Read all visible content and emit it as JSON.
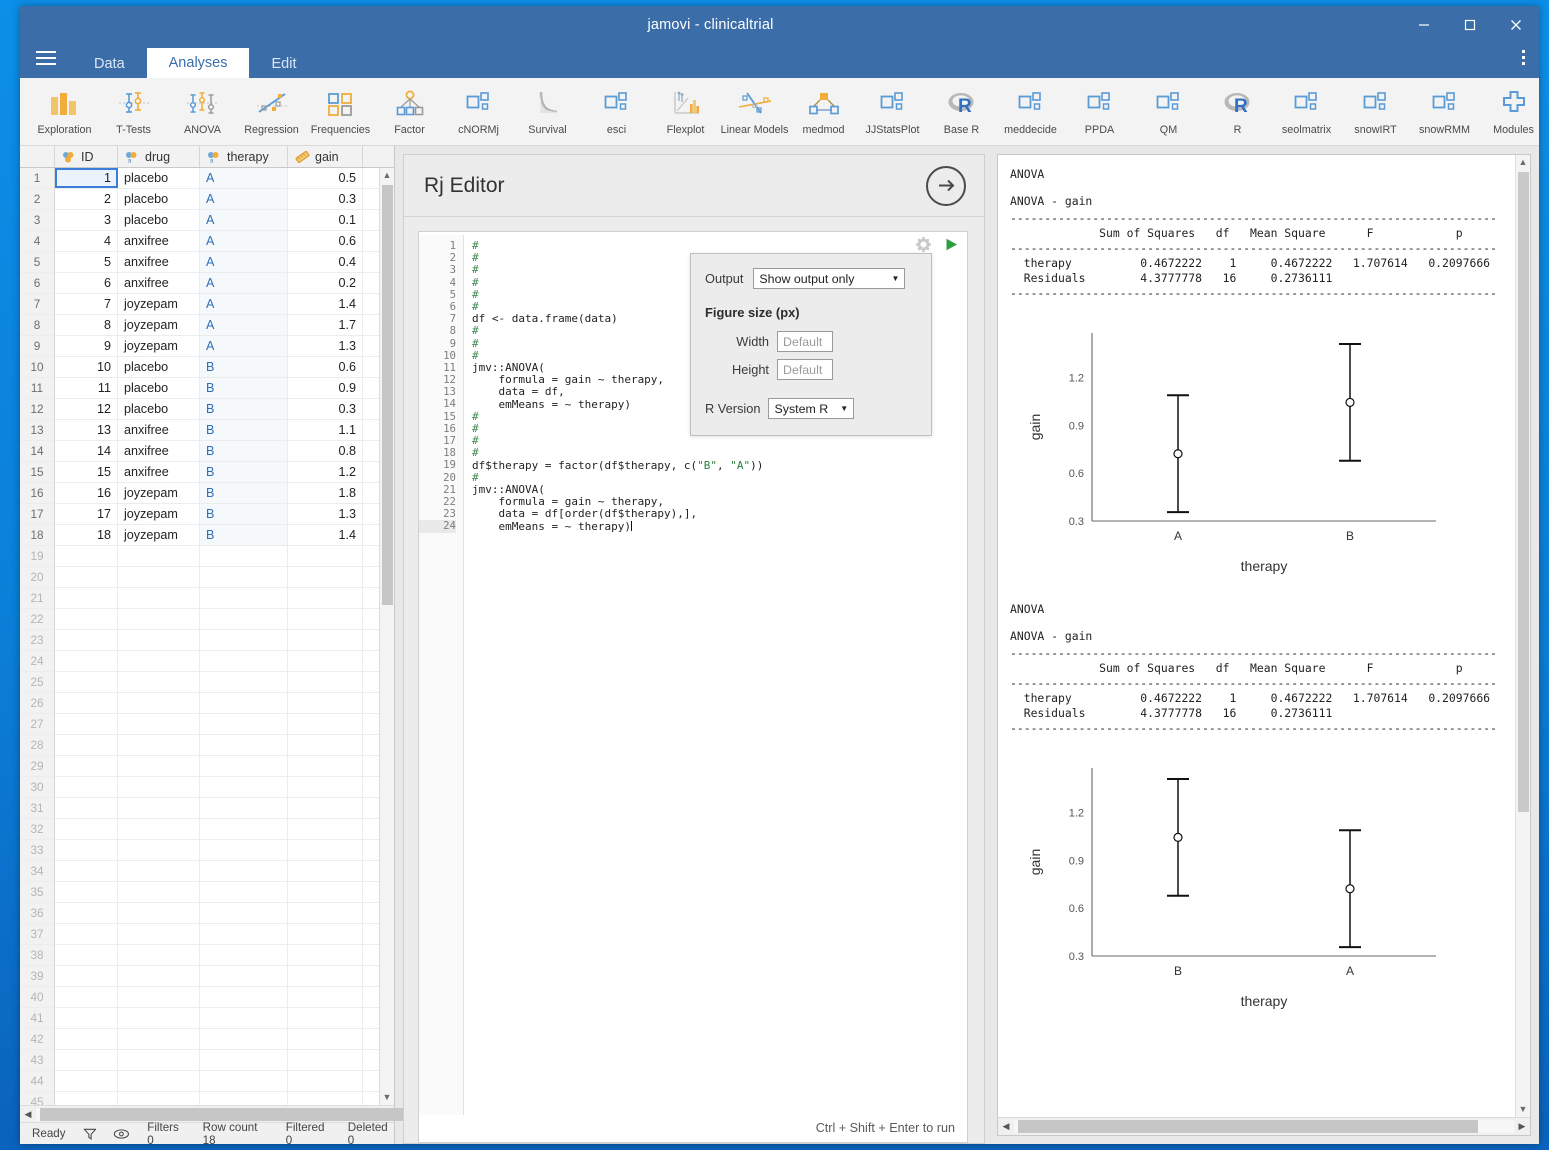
{
  "window": {
    "title": "jamovi - clinicaltrial",
    "minimize": "–",
    "maximize": "❐",
    "close": "✕"
  },
  "tabs": [
    {
      "label": "Data",
      "active": false
    },
    {
      "label": "Analyses",
      "active": true
    },
    {
      "label": "Edit",
      "active": false
    }
  ],
  "ribbon": [
    {
      "label": "Exploration",
      "icon": "bar-chart-icon"
    },
    {
      "label": "T-Tests",
      "icon": "ttest-icon"
    },
    {
      "label": "ANOVA",
      "icon": "anova-icon"
    },
    {
      "label": "Regression",
      "icon": "regression-icon"
    },
    {
      "label": "Frequencies",
      "icon": "frequencies-icon"
    },
    {
      "label": "Factor",
      "icon": "factor-icon"
    },
    {
      "label": "cNORMj",
      "icon": "module-squares-icon"
    },
    {
      "label": "Survival",
      "icon": "survival-curve-icon"
    },
    {
      "label": "esci",
      "icon": "module-squares-icon"
    },
    {
      "label": "Flexplot",
      "icon": "flexplot-icon"
    },
    {
      "label": "Linear Models",
      "icon": "linear-models-icon"
    },
    {
      "label": "medmod",
      "icon": "medmod-icon"
    },
    {
      "label": "JJStatsPlot",
      "icon": "module-squares-icon"
    },
    {
      "label": "Base R",
      "icon": "r-logo-icon"
    },
    {
      "label": "meddecide",
      "icon": "module-squares-icon"
    },
    {
      "label": "PPDA",
      "icon": "module-squares-icon"
    },
    {
      "label": "QM",
      "icon": "module-squares-icon"
    },
    {
      "label": "R",
      "icon": "r-logo-icon"
    },
    {
      "label": "seolmatrix",
      "icon": "module-squares-icon"
    },
    {
      "label": "snowIRT",
      "icon": "module-squares-icon"
    },
    {
      "label": "snowRMM",
      "icon": "module-squares-icon"
    },
    {
      "label": "Modules",
      "icon": "plus-cross-icon"
    }
  ],
  "spreadsheet": {
    "columns": [
      {
        "name": "ID",
        "icon": "nominal-icon"
      },
      {
        "name": "drug",
        "icon": "nominal-text-icon"
      },
      {
        "name": "therapy",
        "icon": "nominal-text-icon"
      },
      {
        "name": "gain",
        "icon": "continuous-ruler-icon"
      }
    ],
    "rows": [
      {
        "n": "1",
        "ID": "1",
        "drug": "placebo",
        "therapy": "A",
        "gain": "0.5"
      },
      {
        "n": "2",
        "ID": "2",
        "drug": "placebo",
        "therapy": "A",
        "gain": "0.3"
      },
      {
        "n": "3",
        "ID": "3",
        "drug": "placebo",
        "therapy": "A",
        "gain": "0.1"
      },
      {
        "n": "4",
        "ID": "4",
        "drug": "anxifree",
        "therapy": "A",
        "gain": "0.6"
      },
      {
        "n": "5",
        "ID": "5",
        "drug": "anxifree",
        "therapy": "A",
        "gain": "0.4"
      },
      {
        "n": "6",
        "ID": "6",
        "drug": "anxifree",
        "therapy": "A",
        "gain": "0.2"
      },
      {
        "n": "7",
        "ID": "7",
        "drug": "joyzepam",
        "therapy": "A",
        "gain": "1.4"
      },
      {
        "n": "8",
        "ID": "8",
        "drug": "joyzepam",
        "therapy": "A",
        "gain": "1.7"
      },
      {
        "n": "9",
        "ID": "9",
        "drug": "joyzepam",
        "therapy": "A",
        "gain": "1.3"
      },
      {
        "n": "10",
        "ID": "10",
        "drug": "placebo",
        "therapy": "B",
        "gain": "0.6"
      },
      {
        "n": "11",
        "ID": "11",
        "drug": "placebo",
        "therapy": "B",
        "gain": "0.9"
      },
      {
        "n": "12",
        "ID": "12",
        "drug": "placebo",
        "therapy": "B",
        "gain": "0.3"
      },
      {
        "n": "13",
        "ID": "13",
        "drug": "anxifree",
        "therapy": "B",
        "gain": "1.1"
      },
      {
        "n": "14",
        "ID": "14",
        "drug": "anxifree",
        "therapy": "B",
        "gain": "0.8"
      },
      {
        "n": "15",
        "ID": "15",
        "drug": "anxifree",
        "therapy": "B",
        "gain": "1.2"
      },
      {
        "n": "16",
        "ID": "16",
        "drug": "joyzepam",
        "therapy": "B",
        "gain": "1.8"
      },
      {
        "n": "17",
        "ID": "17",
        "drug": "joyzepam",
        "therapy": "B",
        "gain": "1.3"
      },
      {
        "n": "18",
        "ID": "18",
        "drug": "joyzepam",
        "therapy": "B",
        "gain": "1.4"
      }
    ],
    "empty_row_start": 19,
    "empty_row_end": 45
  },
  "statusbar": {
    "ready": "Ready",
    "filter_icon": "filter-icon",
    "eye_icon": "eye-icon",
    "filters": "Filters 0",
    "row_count": "Row count 18",
    "filtered": "Filtered 0",
    "deleted": "Deleted 0"
  },
  "rj": {
    "title": "Rj Editor",
    "forward_icon": "arrow-right-circle-icon",
    "gear_icon": "gear-icon",
    "run_icon": "play-run-icon",
    "run_hint": "Ctrl + Shift + Enter to run",
    "code_lines": [
      "#",
      "#",
      "#",
      "#",
      "#",
      "#",
      "df <- data.frame(data)",
      "#",
      "#",
      "#",
      "jmv::ANOVA(",
      "    formula = gain ~ therapy,",
      "    data = df,",
      "    emMeans = ~ therapy)",
      "#",
      "#",
      "#",
      "#",
      "df$therapy = factor(df$therapy, c(\"B\", \"A\"))",
      "#",
      "jmv::ANOVA(",
      "    formula = gain ~ therapy,",
      "    data = df[order(df$therapy),],",
      "    emMeans = ~ therapy)"
    ],
    "cursor_line": 24
  },
  "settings_popup": {
    "output_label": "Output",
    "output_value": "Show output only",
    "figure_size_heading": "Figure size (px)",
    "width_label": "Width",
    "width_placeholder": "Default",
    "height_label": "Height",
    "height_placeholder": "Default",
    "r_version_label": "R Version",
    "r_version_value": "System R"
  },
  "results": {
    "blocks": [
      {
        "heading": "ANOVA",
        "subheading": "ANOVA - gain",
        "rule": "-----------------------------------------------------------------------",
        "columns": "             Sum of Squares   df   Mean Square      F            p",
        "rows": [
          "  therapy          0.4672222    1     0.4672222   1.707614   0.2097666",
          "  Residuals        4.3777778   16     0.2736111"
        ]
      },
      {
        "heading": "ANOVA",
        "subheading": "ANOVA - gain",
        "rule": "-----------------------------------------------------------------------",
        "columns": "             Sum of Squares   df   Mean Square      F            p",
        "rows": [
          "  therapy          0.4672222    1     0.4672222   1.707614   0.2097666",
          "  Residuals        4.3777778   16     0.2736111"
        ]
      }
    ]
  },
  "chart_data": [
    {
      "type": "scatter",
      "title": "",
      "xlabel": "therapy",
      "ylabel": "gain",
      "categories": [
        "A",
        "B"
      ],
      "values": [
        0.7222,
        1.0444
      ],
      "ci_lower": [
        0.3556,
        0.6778
      ],
      "ci_upper": [
        1.0889,
        1.4111
      ],
      "ytick_labels": [
        "0.3",
        "0.6",
        "0.9",
        "1.2"
      ],
      "ytick_values": [
        0.3,
        0.6,
        0.9,
        1.2
      ],
      "ylim": [
        0.3,
        1.48
      ],
      "grid": false,
      "legend": "none"
    },
    {
      "type": "scatter",
      "title": "",
      "xlabel": "therapy",
      "ylabel": "gain",
      "categories": [
        "B",
        "A"
      ],
      "values": [
        1.0444,
        0.7222
      ],
      "ci_lower": [
        0.6778,
        0.3556
      ],
      "ci_upper": [
        1.4111,
        1.0889
      ],
      "ytick_labels": [
        "0.3",
        "0.6",
        "0.9",
        "1.2"
      ],
      "ytick_values": [
        0.3,
        0.6,
        0.9,
        1.2
      ],
      "ylim": [
        0.3,
        1.48
      ],
      "grid": false,
      "legend": "none"
    }
  ],
  "colors": {
    "titlebar": "#3b6da8",
    "accent_blue": "#3e7fd4",
    "accent_orange": "#f0ad3c",
    "desktop": "#0b84e0"
  }
}
